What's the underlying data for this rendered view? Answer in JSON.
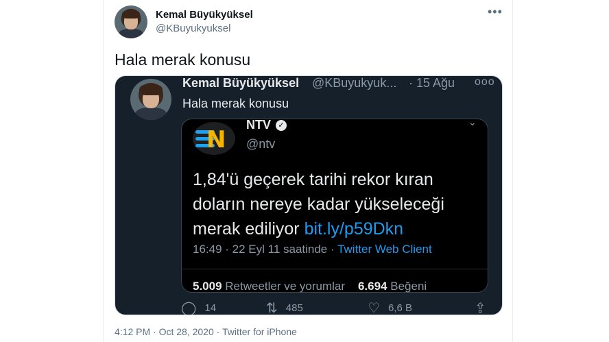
{
  "tweet": {
    "author_name": "Kemal Büyükyüksel",
    "author_handle": "@KBuyukyuksel",
    "text": "Hala merak konusu",
    "more_icon": "more-icon",
    "timestamp": "4:12 PM · Oct 28, 2020",
    "separator": " · ",
    "client": "Twitter for iPhone"
  },
  "embedded": {
    "author_name": "Kemal Büyükyüksel",
    "author_handle": "@KBuyukyuk...",
    "date": "· 15 Ağu",
    "text": "Hala merak konusu",
    "quote": {
      "name": "NTV",
      "handle": "@ntv",
      "line1": "1,84'ü geçerek tarihi rekor kıran",
      "line2": "doların nereye kadar yükseleceği",
      "line3_prefix": "merak ediliyor ",
      "link": "bit.ly/p59Dkn",
      "meta": "16:49 · 22 Eyl 11 saatinde · ",
      "client": "Twitter Web Client",
      "retweets_count": "5.009",
      "retweets_label": " Retweetler ve yorumlar",
      "likes_count": "6.694",
      "likes_label": " Beğeni"
    },
    "actions": {
      "replies": "14",
      "retweets": "485",
      "likes": "6,6 B"
    }
  },
  "colors": {
    "link": "#1d9bf0",
    "dark_bg": "#15202b",
    "muted": "#5b7083"
  }
}
